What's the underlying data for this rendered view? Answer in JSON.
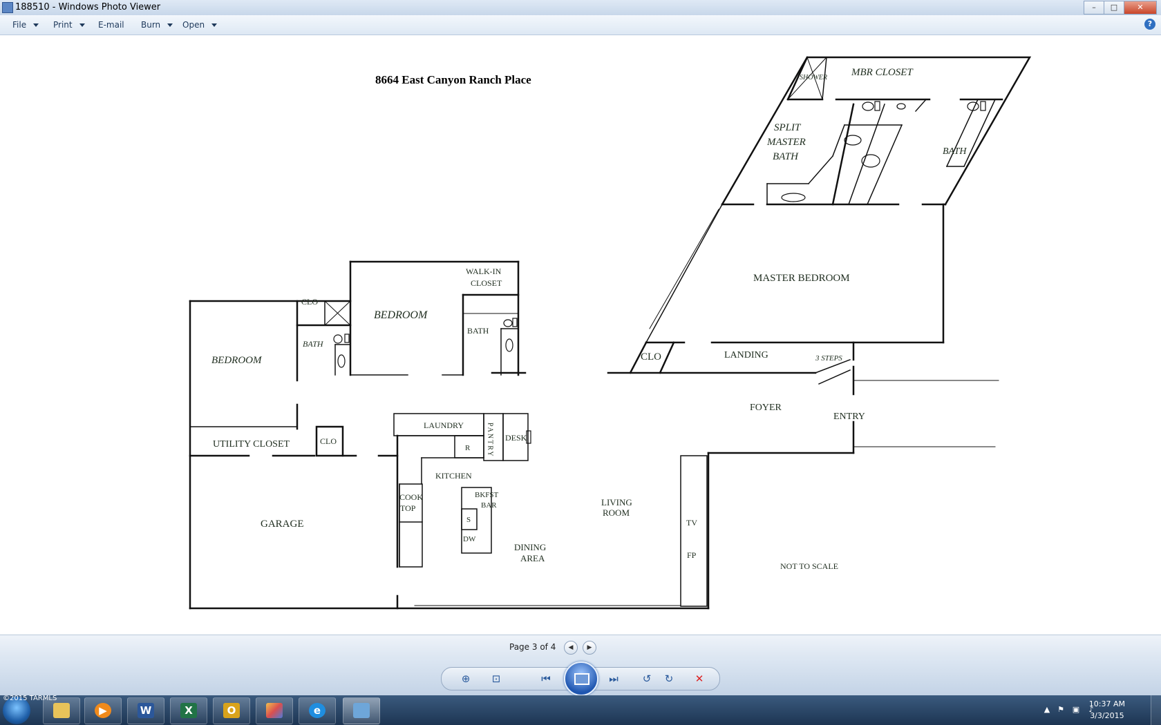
{
  "window": {
    "title": "188510 - Windows Photo Viewer",
    "minimize": "–",
    "maximize": "□",
    "close": "✕"
  },
  "menu": {
    "file": "File",
    "print": "Print",
    "email": "E-mail",
    "burn": "Burn",
    "open": "Open",
    "help": "?"
  },
  "floorplan": {
    "address": "8664 East Canyon Ranch Place",
    "rooms": {
      "shower": "SHOWER",
      "mbr_closet": "MBR CLOSET",
      "split_master_bath_1": "SPLIT",
      "split_master_bath_2": "MASTER",
      "split_master_bath_3": "BATH",
      "bath_right": "BATH",
      "master_bedroom": "MASTER BEDROOM",
      "walk_in_closet_1": "WALK-IN",
      "walk_in_closet_2": "CLOSET",
      "bedroom_middle": "BEDROOM",
      "bath_middle": "BATH",
      "clo_left": "CLO",
      "bath_left": "BATH",
      "bedroom_left": "BEDROOM",
      "clo_landing": "CLO",
      "landing": "LANDING",
      "steps": "3 STEPS",
      "foyer": "FOYER",
      "entry": "ENTRY",
      "utility_closet": "UTILITY CLOSET",
      "clo_utility": "CLO",
      "laundry": "LAUNDRY",
      "pantry": "PANTRY",
      "desk": "DESK",
      "refrigerator": "R",
      "kitchen": "KITCHEN",
      "cooktop_1": "COOK",
      "cooktop_2": "TOP",
      "bkfst_bar_1": "BKFST",
      "bkfst_bar_2": "BAR",
      "sink": "S",
      "dishwasher": "DW",
      "living_room_1": "LIVING",
      "living_room_2": "ROOM",
      "dining_area_1": "DINING",
      "dining_area_2": "AREA",
      "garage": "GARAGE",
      "tv": "TV",
      "fireplace": "FP",
      "not_to_scale": "NOT TO SCALE"
    }
  },
  "status": {
    "page_info": "Page 3 of 4"
  },
  "taskbar": {
    "copyright": "©2015 TARMLS",
    "clock_time": "10:37 AM",
    "clock_date": "3/3/2015",
    "apps": [
      "explorer",
      "media-player",
      "word",
      "excel",
      "outlook",
      "paint",
      "internet-explorer",
      "photo-viewer"
    ]
  },
  "colors": {
    "accent": "#2f6fc1",
    "plan_ink": "#111111",
    "label_ink": "#1f2d1f"
  }
}
